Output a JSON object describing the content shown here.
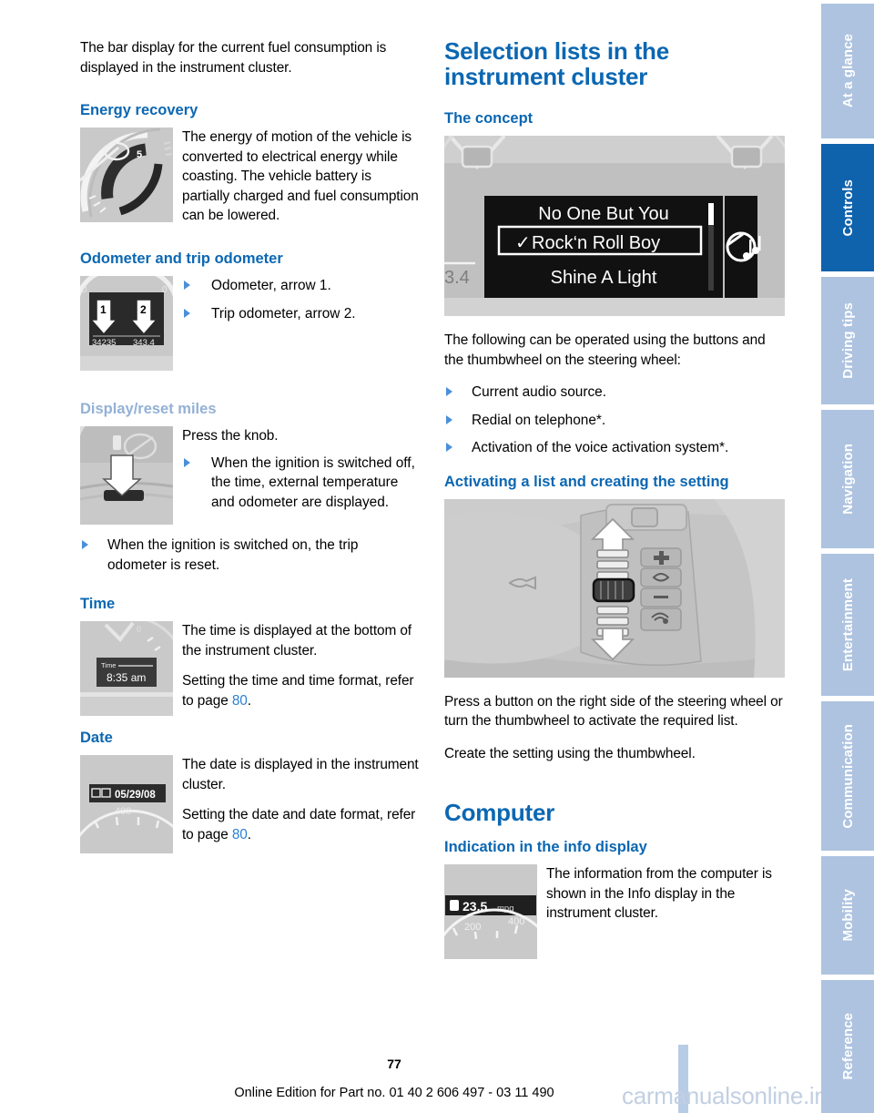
{
  "document": {
    "page_number": "77",
    "footer_text": "Online Edition for Part no. 01 40 2 606 497 - 03 11 490",
    "watermark": "carmanualsonline.info",
    "accent_blue": "#0b67b2",
    "muted_blue": "#93b1d6",
    "tab_blue": "#aec3e0",
    "tab_active_blue": "#0f62ac",
    "link_blue": "#2a7fd4"
  },
  "left_column": {
    "intro_paragraph": "The bar display for the current fuel consumption is displayed in the instrument cluster.",
    "energy_recovery": {
      "heading": "Energy recovery",
      "paragraph": "The energy of motion of the vehicle is converted to electrical energy while coasting. The vehicle battery is partially charged and fuel consumption can be lowered.",
      "figure_name": "tachometer-energy-recovery-gauge",
      "figure_label": "5"
    },
    "odometer": {
      "heading": "Odometer and trip odometer",
      "bullets": [
        "Odometer, arrow 1.",
        "Trip odometer, arrow 2."
      ],
      "figure_name": "instrument-cluster-odometer",
      "figure_values": {
        "odometer": "34235",
        "trip": "343.4",
        "arrow_1": "1",
        "arrow_2": "2"
      }
    },
    "display_reset_miles": {
      "heading": "Display/reset miles",
      "lead": "Press the knob.",
      "bullet_indented": "When the ignition is switched off, the time, external temperature and odometer are displayed.",
      "bullet_outdented": "When the ignition is switched on, the trip odometer is reset.",
      "figure_name": "reset-knob-press-down"
    },
    "time": {
      "heading": "Time",
      "paragraph_1": "The time is displayed at the bottom of the instrument cluster.",
      "paragraph_2_before": "Setting the time and time format, refer to page ",
      "paragraph_2_page": "80",
      "paragraph_2_after": ".",
      "figure_name": "instrument-cluster-time-display",
      "figure_values": {
        "label": "Time",
        "value": "8:35 am"
      }
    },
    "date": {
      "heading": "Date",
      "paragraph_1": "The date is displayed in the instrument cluster.",
      "paragraph_2_before": "Setting the date and date format, refer to page ",
      "paragraph_2_page": "80",
      "paragraph_2_after": ".",
      "figure_name": "instrument-cluster-date-display",
      "figure_values": {
        "date": "05/29/08",
        "scale": "400"
      }
    }
  },
  "right_column": {
    "chapter_title": "Selection lists in the instrument cluster",
    "concept": {
      "heading": "The concept",
      "figure_name": "instrument-cluster-selection-list",
      "figure_values": {
        "item_1": "No One But You",
        "item_2": "Rock'n Roll Boy",
        "item_3": "Shine A Light",
        "checkmark": "✓",
        "trip_value": "3.4"
      },
      "paragraph": "The following can be operated using the buttons and the thumbwheel on the steering wheel:",
      "bullets": [
        "Current audio source.",
        "Redial on telephone*.",
        "Activation of the voice activation system*."
      ]
    },
    "activating": {
      "heading": "Activating a list and creating the setting",
      "figure_name": "steering-wheel-thumbwheel-controls",
      "paragraph_1": "Press a button on the right side of the steering wheel or turn the thumbwheel to activate the required list.",
      "paragraph_2": "Create the setting using the thumbwheel."
    },
    "computer": {
      "chapter_title": "Computer",
      "heading": "Indication in the info display",
      "paragraph": "The information from the computer is shown in the Info display in the instrument cluster.",
      "figure_name": "info-display-fuel-economy",
      "figure_values": {
        "consumption": "23.5",
        "unit": "mpg",
        "scale_low": "200",
        "scale_high": "400"
      }
    }
  },
  "tabs": [
    {
      "label": "At a glance",
      "active": false
    },
    {
      "label": "Controls",
      "active": true
    },
    {
      "label": "Driving tips",
      "active": false
    },
    {
      "label": "Navigation",
      "active": false
    },
    {
      "label": "Entertainment",
      "active": false
    },
    {
      "label": "Communication",
      "active": false
    },
    {
      "label": "Mobility",
      "active": false
    },
    {
      "label": "Reference",
      "active": false
    }
  ]
}
